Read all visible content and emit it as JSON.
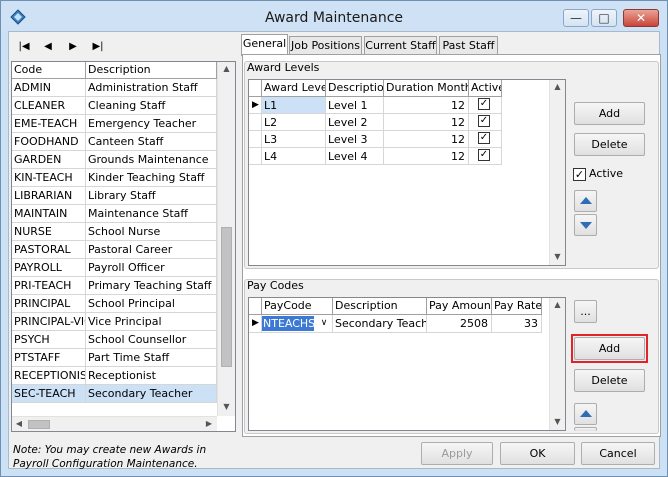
{
  "window": {
    "title": "Award Maintenance"
  },
  "nav": {
    "first": "|◀",
    "prev": "◀",
    "next": "▶",
    "last": "▶|"
  },
  "award_list": {
    "columns": [
      "Code",
      "Description"
    ],
    "rows": [
      [
        "ADMIN",
        "Administration Staff"
      ],
      [
        "CLEANER",
        "Cleaning Staff"
      ],
      [
        "EME-TEACH",
        "Emergency Teacher"
      ],
      [
        "FOODHAND",
        "Canteen Staff"
      ],
      [
        "GARDEN",
        "Grounds Maintenance"
      ],
      [
        "KIN-TEACH",
        "Kinder Teaching Staff"
      ],
      [
        "LIBRARIAN",
        "Library Staff"
      ],
      [
        "MAINTAIN",
        "Maintenance Staff"
      ],
      [
        "NURSE",
        "School Nurse"
      ],
      [
        "PASTORAL",
        "Pastoral Career"
      ],
      [
        "PAYROLL",
        "Payroll Officer"
      ],
      [
        "PRI-TEACH",
        "Primary Teaching Staff"
      ],
      [
        "PRINCIPAL",
        "School Principal"
      ],
      [
        "PRINCIPAL-VIC",
        "Vice Principal"
      ],
      [
        "PSYCH",
        "School Counsellor"
      ],
      [
        "PTSTAFF",
        "Part Time Staff"
      ],
      [
        "RECEPTIONIST",
        "Receptionist"
      ],
      [
        "SEC-TEACH",
        "Secondary Teacher"
      ]
    ],
    "selected_index": 17
  },
  "tabs": [
    "General",
    "Job Positions",
    "Current Staff",
    "Past Staff"
  ],
  "award_levels": {
    "label": "Award Levels",
    "columns": [
      "Award Level",
      "Description",
      "Duration Months",
      "Active"
    ],
    "rows": [
      {
        "level": "L1",
        "description": "Level 1",
        "duration": "12",
        "active": true
      },
      {
        "level": "L2",
        "description": "Level 2",
        "duration": "12",
        "active": true
      },
      {
        "level": "L3",
        "description": "Level 3",
        "duration": "12",
        "active": true
      },
      {
        "level": "L4",
        "description": "Level 4",
        "duration": "12",
        "active": true
      }
    ],
    "add_label": "Add",
    "delete_label": "Delete",
    "active_label": "Active",
    "active_checked": true
  },
  "pay_codes": {
    "label": "Pay Codes",
    "columns": [
      "PayCode",
      "Description",
      "Pay Amount",
      "Pay Rate"
    ],
    "rows": [
      {
        "paycode": "NTEACHS",
        "description": "Secondary Teach",
        "amount": "2508",
        "rate": "33"
      }
    ],
    "ellipsis_label": "...",
    "add_label": "Add",
    "delete_label": "Delete"
  },
  "note": "Note: You may create new Awards in Payroll Configuration Maintenance.",
  "footer": {
    "apply_label": "Apply",
    "ok_label": "OK",
    "cancel_label": "Cancel"
  },
  "colors": {
    "highlight": "#e1232a",
    "selection": "#cce0f6",
    "accent": "#2f6eb5"
  }
}
